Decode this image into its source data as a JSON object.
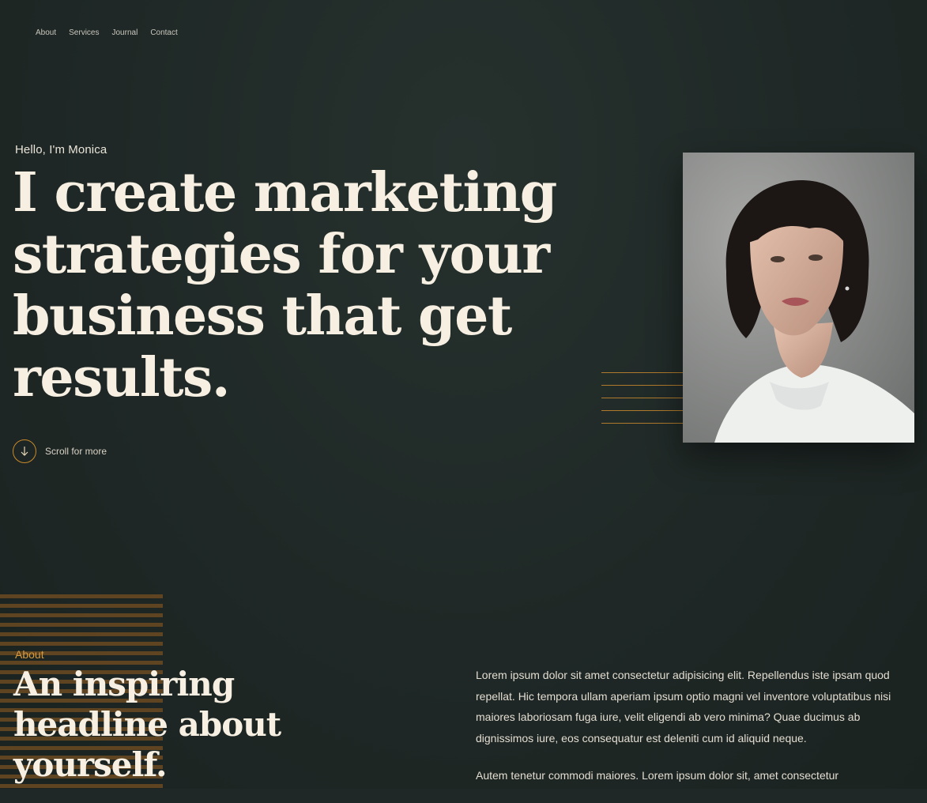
{
  "nav": {
    "items": [
      "About",
      "Services",
      "Journal",
      "Contact"
    ]
  },
  "hero": {
    "greeting": "Hello, I'm Monica",
    "title": "I create marketing strategies for your business that get results.",
    "scroll_label": "Scroll for more",
    "scroll_icon": "arrow-down-icon"
  },
  "about": {
    "label": "About",
    "title": "An inspiring headline about yourself.",
    "paragraph1": "Lorem ipsum dolor sit amet consectetur adipisicing elit. Repellendus iste ipsam quod repellat. Hic tempora ullam aperiam ipsum optio magni vel inventore voluptatibus nisi maiores laboriosam fuga iure, velit eligendi ab vero minima? Quae ducimus ab dignissimos iure, eos consequatur est deleniti cum id aliquid neque.",
    "paragraph2": "Autem tenetur commodi maiores. Lorem ipsum dolor sit, amet consectetur"
  },
  "colors": {
    "background": "#1f2826",
    "accent": "#c98a2a",
    "heading": "#f6efe2"
  }
}
